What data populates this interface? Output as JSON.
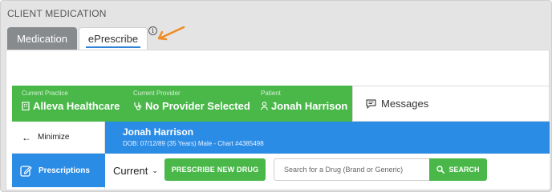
{
  "panel": {
    "title": "CLIENT MEDICATION"
  },
  "tabs": [
    {
      "label": "Medication",
      "active": false
    },
    {
      "label": "ePrescribe",
      "active": true
    }
  ],
  "info_icon_glyph": "i",
  "banner": {
    "practice": {
      "label": "Current Practice",
      "value": "Alleva Healthcare",
      "icon": "building-icon"
    },
    "provider": {
      "label": "Current Provider",
      "value": "No Provider Selected",
      "icon": "stethoscope-icon"
    },
    "patient": {
      "label": "Patient",
      "value": "Jonah Harrison",
      "icon": "person-icon"
    },
    "messages_label": "Messages"
  },
  "sidebar": {
    "minimize_label": "Minimize",
    "prescriptions_label": "Prescriptions"
  },
  "patient_header": {
    "name": "Jonah Harrison",
    "details": "DOB: 07/12/89 (35 Years) Male - Chart #4385498"
  },
  "toolbar": {
    "filter_value": "Current",
    "prescribe_button": "PRESCRIBE NEW DRUG",
    "search_placeholder": "Search for a Drug (Brand or Generic)",
    "search_button": "SEARCH"
  },
  "colors": {
    "green": "#49b849",
    "blue": "#2b8ce6",
    "arrow_annotation": "#f08a24"
  }
}
